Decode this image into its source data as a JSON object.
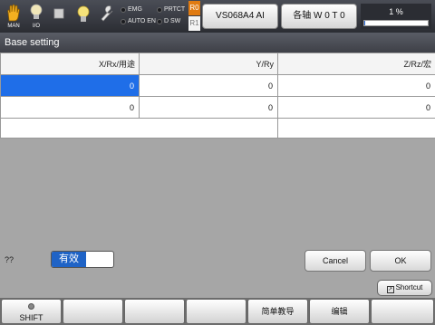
{
  "topbar": {
    "man_label": "MAN",
    "io_label": "I/O",
    "lamps": {
      "emg": "EMG",
      "auto_en": "AUTO EN",
      "prtct": "PRTCT",
      "d_sw": "D SW"
    },
    "r0": "R0",
    "r1": "R1",
    "robot_label": "VS068A4 AI",
    "axis_label": "各轴 W 0 T 0",
    "speed_label": "1 %",
    "speed_value": 0.01,
    "icons": [
      "hand-icon",
      "lightbulb-io-icon",
      "stop-square-icon",
      "lightbulb-icon",
      "wrench-icon"
    ]
  },
  "title": "Base setting",
  "table": {
    "headers": [
      "X/Rx/用途",
      "Y/Ry",
      "Z/Rz/宏"
    ],
    "rows": [
      [
        "0",
        "0",
        "0"
      ],
      [
        "0",
        "0",
        "0"
      ]
    ],
    "selected_color": "#1f6ee8"
  },
  "footer": {
    "qq_label": "??",
    "toggle_label": "有效",
    "cancel_label": "Cancel",
    "ok_label": "OK",
    "shortcut_label": "Shortcut"
  },
  "fkeys": [
    "SHIFT",
    "",
    "",
    "",
    "简单教导",
    "编辑",
    ""
  ]
}
